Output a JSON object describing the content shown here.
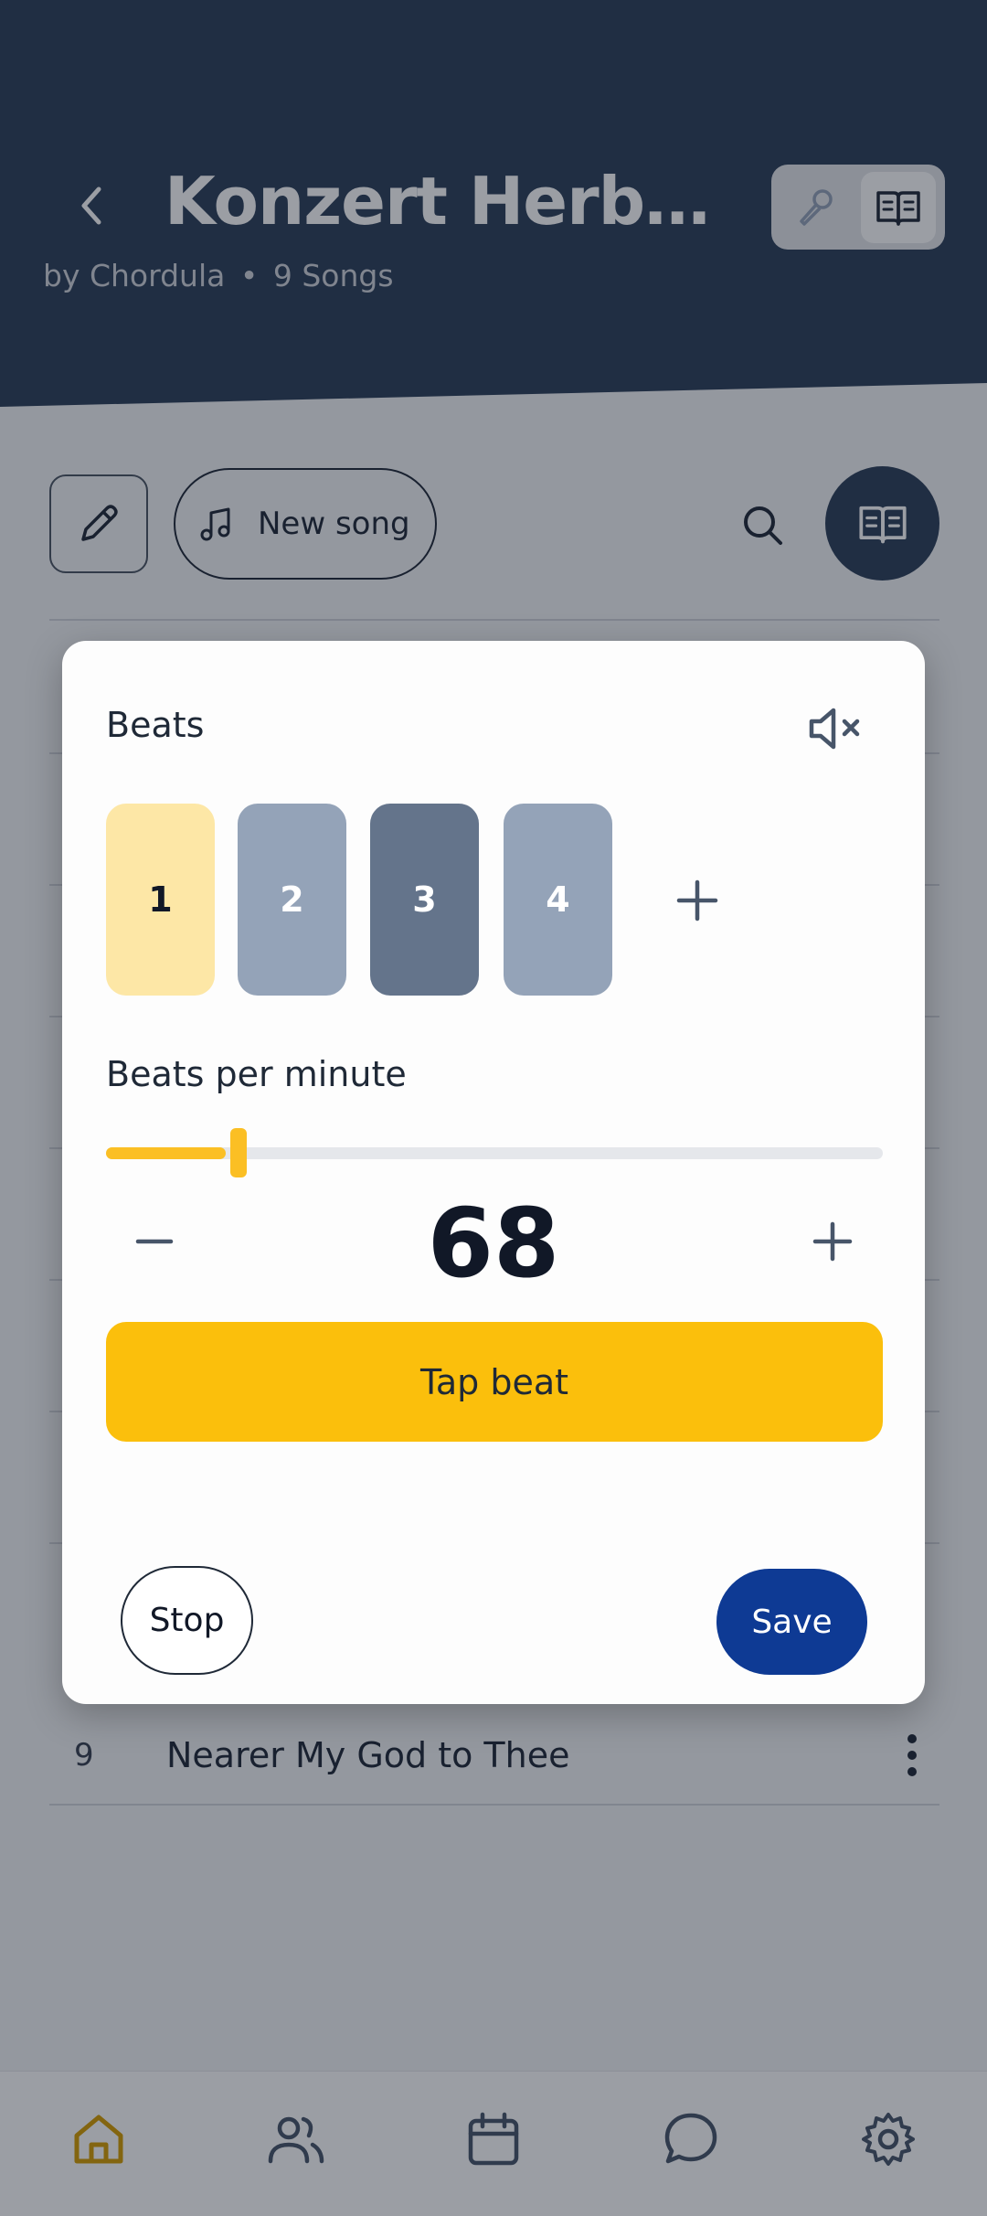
{
  "header": {
    "title": "Konzert Herber...",
    "subtitle_author": "by Chordula",
    "subtitle_separator": "•",
    "subtitle_count": "9 Songs"
  },
  "toolbar": {
    "new_song_label": "New song"
  },
  "song_list": [
    {
      "number": "9",
      "title": "Nearer My God to Thee"
    }
  ],
  "metronome": {
    "title": "Beats",
    "beats": [
      {
        "label": "1",
        "state": "accent",
        "color": "#fde7a6",
        "text_color": "#111827"
      },
      {
        "label": "2",
        "state": "off",
        "color": "#94a3b8",
        "text_color": "#ffffff"
      },
      {
        "label": "3",
        "state": "active",
        "color": "#64748b",
        "text_color": "#ffffff"
      },
      {
        "label": "4",
        "state": "off",
        "color": "#94a3b8",
        "text_color": "#ffffff"
      }
    ],
    "bpm_label": "Beats per minute",
    "bpm_value": "68",
    "bpm_slider_fraction": 0.17,
    "tap_label": "Tap beat",
    "stop_label": "Stop",
    "save_label": "Save"
  },
  "colors": {
    "header_bg": "#2c3e58",
    "accent_yellow": "#fbbf0c",
    "primary_blue": "#0e3a94",
    "nav_active": "#d69e00",
    "icon_gray": "#475569"
  },
  "icons": {
    "back": "chevron-left-icon",
    "mode_1": "microphone-icon",
    "mode_2": "book-open-icon",
    "edit": "pencil-icon",
    "new_song": "music-note-icon",
    "search": "search-icon",
    "reader": "book-open-icon",
    "mute": "speaker-muted-icon",
    "more": "more-vertical-icon",
    "nav": [
      "home-icon",
      "users-icon",
      "calendar-icon",
      "chat-icon",
      "gear-icon"
    ]
  }
}
